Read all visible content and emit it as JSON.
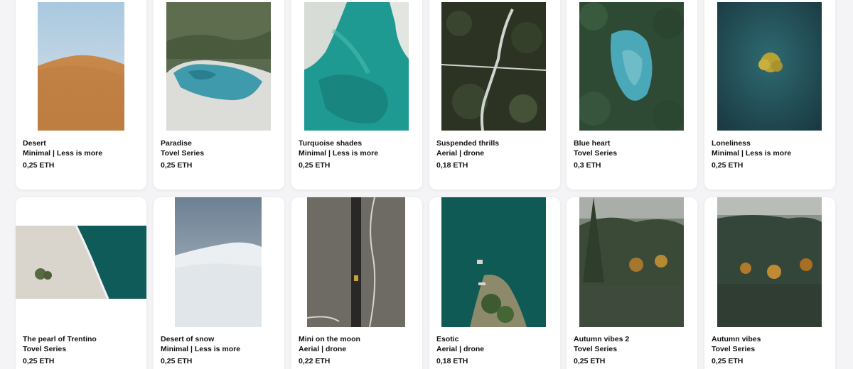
{
  "cards": [
    {
      "title": "Desert",
      "series": "Minimal | Less is more",
      "price": "0,25 ETH",
      "art": "desert"
    },
    {
      "title": "Paradise",
      "series": "Tovel Series",
      "price": "0,25 ETH",
      "art": "paradise"
    },
    {
      "title": "Turquoise shades",
      "series": "Minimal | Less is more",
      "price": "0,25 ETH",
      "art": "turquoise"
    },
    {
      "title": "Suspended thrills",
      "series": "Aerial | drone",
      "price": "0,18 ETH",
      "art": "suspended"
    },
    {
      "title": "Blue heart",
      "series": "Tovel Series",
      "price": "0,3 ETH",
      "art": "blueheart"
    },
    {
      "title": "Loneliness",
      "series": "Minimal | Less is more",
      "price": "0,25 ETH",
      "art": "loneliness"
    },
    {
      "title": "The pearl of Trentino",
      "series": "Tovel Series",
      "price": "0,25 ETH",
      "art": "pearl"
    },
    {
      "title": "Desert of snow",
      "series": "Minimal | Less is more",
      "price": "0,25 ETH",
      "art": "snow"
    },
    {
      "title": "Mini on the moon",
      "series": "Aerial | drone",
      "price": "0,22 ETH",
      "art": "moon"
    },
    {
      "title": "Esotic",
      "series": "Aerial | drone",
      "price": "0,18 ETH",
      "art": "esotic"
    },
    {
      "title": "Autumn vibes 2",
      "series": "Tovel Series",
      "price": "0,25 ETH",
      "art": "autumn2"
    },
    {
      "title": "Autumn vibes",
      "series": "Tovel Series",
      "price": "0,25 ETH",
      "art": "autumn"
    }
  ]
}
